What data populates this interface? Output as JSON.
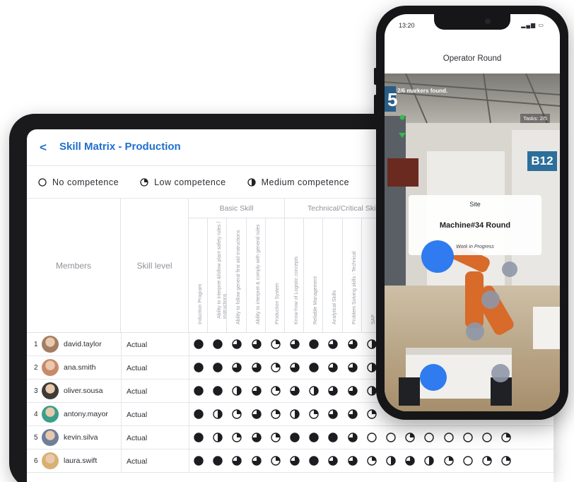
{
  "colors": {
    "accent": "#1e6fd0",
    "marker_active": "#2f7bef",
    "marker_inactive": "#8f97a8",
    "found_green": "#2fbf4a"
  },
  "skill_matrix": {
    "back_icon": "chevron-left-icon",
    "title": "Skill Matrix - Production",
    "legend": [
      {
        "label": "No competence",
        "level": 0
      },
      {
        "label": "Low competence",
        "level": 1
      },
      {
        "label": "Medium competence",
        "level": 2
      }
    ],
    "columns": {
      "members": "Members",
      "skill_level": "Skill level"
    },
    "groups": {
      "basic": "Basic Skill",
      "technical": "Technical/Critical Skills"
    },
    "skills": [
      "Induction Program",
      "Ability to interpret &follow plant safety rules / instructions",
      "Ability to follow general first aid instructions",
      "Ability to interpret & comply with general rules",
      "Production System",
      "Know-how of Logistic concepts",
      "Reliable Management",
      "Analytical Skills",
      "Problem Solving skills - Technical",
      "SAP"
    ],
    "members": [
      {
        "num": "1",
        "name": "david.taylor",
        "level": "Actual",
        "avatar_icon": "avatar-david",
        "scores": [
          4,
          4,
          3,
          3,
          1,
          3,
          4,
          3,
          3,
          2
        ]
      },
      {
        "num": "2",
        "name": "ana.smith",
        "level": "Actual",
        "avatar_icon": "avatar-ana",
        "scores": [
          4,
          4,
          3,
          3,
          1,
          3,
          4,
          3,
          3,
          2
        ]
      },
      {
        "num": "3",
        "name": "oliver.sousa",
        "level": "Actual",
        "avatar_icon": "avatar-oliver",
        "scores": [
          4,
          4,
          2,
          3,
          1,
          3,
          2,
          3,
          3,
          2
        ]
      },
      {
        "num": "4",
        "name": "antony.mayor",
        "level": "Actual",
        "avatar_icon": "avatar-antony",
        "scores": [
          4,
          2,
          1,
          3,
          1,
          2,
          1,
          3,
          3,
          1
        ]
      },
      {
        "num": "5",
        "name": "kevin.silva",
        "level": "Actual",
        "avatar_icon": "avatar-kevin",
        "scores": [
          4,
          2,
          1,
          3,
          1,
          4,
          4,
          4,
          3,
          0,
          0,
          1,
          0,
          0,
          0,
          0,
          1
        ]
      },
      {
        "num": "6",
        "name": "laura.swift",
        "level": "Actual",
        "avatar_icon": "avatar-laura",
        "scores": [
          4,
          4,
          3,
          3,
          1,
          3,
          4,
          3,
          3,
          1,
          2,
          3,
          2,
          1,
          0,
          1,
          1
        ]
      }
    ]
  },
  "phone": {
    "time": "13:20",
    "status_icons": "signal-battery-icons",
    "title": "Operator Round",
    "markers_found": "2/6 markers found.",
    "tasks": "Tasks: 2/5",
    "bay_sign": "B12",
    "sign_5": "5",
    "site_label": "Site",
    "site_name": "Machine#34 Round",
    "site_status": "Work in Progress"
  }
}
